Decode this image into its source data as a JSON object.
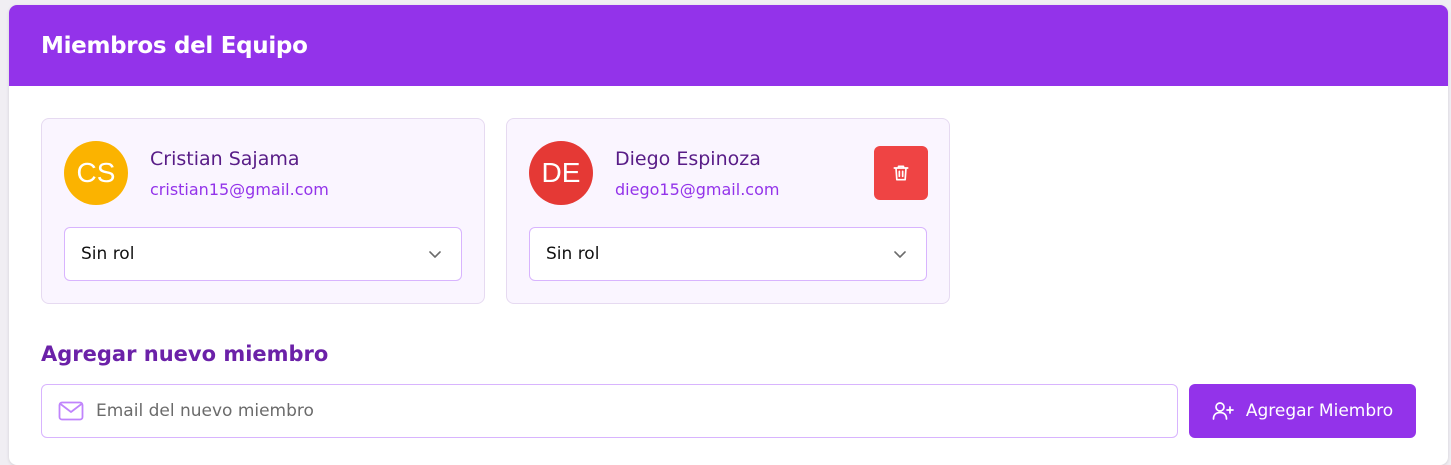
{
  "header": {
    "title": "Miembros del Equipo"
  },
  "members": [
    {
      "initials": "CS",
      "name": "Cristian Sajama",
      "email": "cristian15@gmail.com",
      "avatar_color": "#fbb300",
      "role": "Sin rol"
    },
    {
      "initials": "DE",
      "name": "Diego Espinoza",
      "email": "diego15@gmail.com",
      "avatar_color": "#e53935",
      "role": "Sin rol",
      "delete_icon": "trash-icon"
    }
  ],
  "add_member": {
    "title": "Agregar nuevo miembro",
    "email_placeholder": "Email del nuevo miembro",
    "email_value": "",
    "mail_icon": "mail-icon",
    "button_label": "Agregar Miembro",
    "button_icon": "user-plus-icon"
  },
  "colors": {
    "accent": "#9333ea",
    "card_bg": "#faf5ff",
    "danger": "#ef4444"
  }
}
